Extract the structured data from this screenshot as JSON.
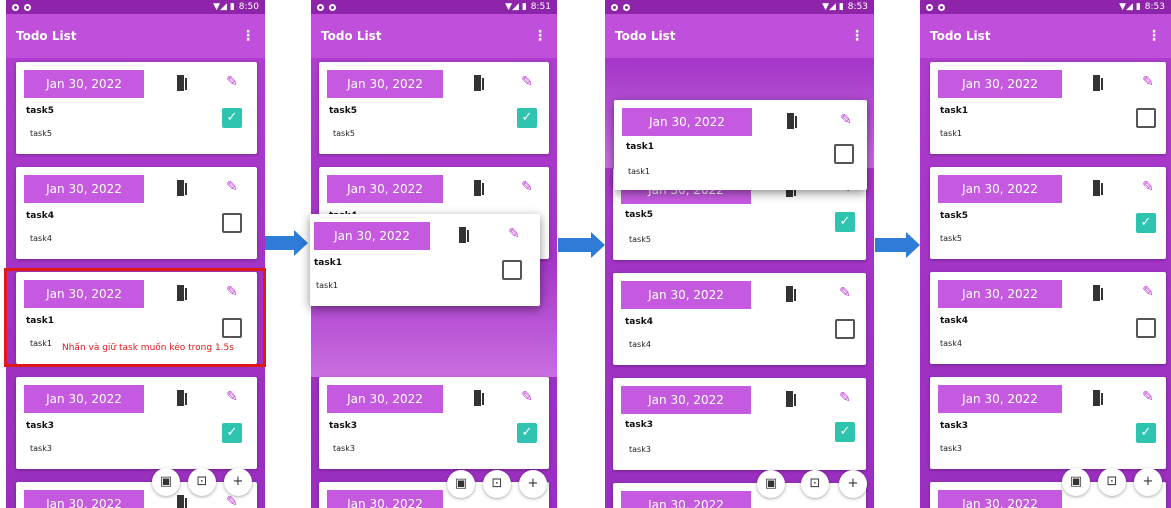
{
  "app": {
    "title": "Todo List",
    "more_icon": "⋮"
  },
  "status": {
    "time_1": "8:50",
    "time_2": "8:51",
    "time_3": "8:53",
    "time_4": "8:53"
  },
  "common": {
    "date": "Jan 30, 2022",
    "checked_mark": "✓",
    "edit_glyph": "✎"
  },
  "fabs": {
    "image": "image-icon",
    "scan": "scan-icon",
    "add": "+"
  },
  "annotation": {
    "text": "Nhấn và giữ task muốn kéo trong 1.5s"
  },
  "tasks": {
    "task5": {
      "title": "task5",
      "desc": "task5",
      "done": true
    },
    "task4": {
      "title": "task4",
      "desc": "task4",
      "done": false
    },
    "task1": {
      "title": "task1",
      "desc": "task1",
      "done": false
    },
    "task3": {
      "title": "task3",
      "desc": "task3",
      "done": true
    }
  },
  "colors": {
    "purple": "#c04fdc",
    "date_bg": "#c55ae0",
    "check": "#2ec4b0",
    "arrow": "#2f7bd8",
    "highlight": "#e01818"
  }
}
